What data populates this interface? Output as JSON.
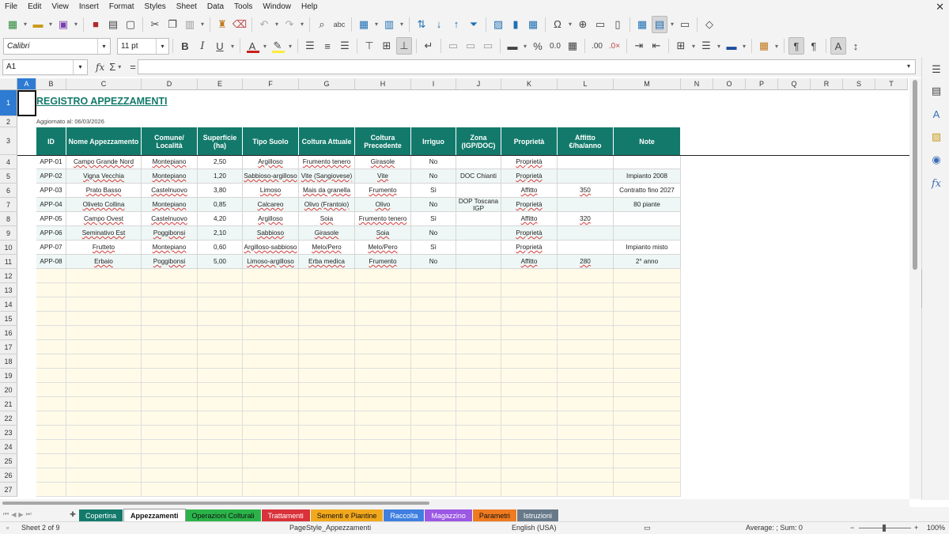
{
  "menu": [
    "File",
    "Edit",
    "View",
    "Insert",
    "Format",
    "Styles",
    "Sheet",
    "Data",
    "Tools",
    "Window",
    "Help"
  ],
  "close_glyph": "✕",
  "toolbar2": {
    "font_name": "Calibri",
    "font_size": "11 pt"
  },
  "formula_bar": {
    "cell_ref": "A1",
    "fx": "fx",
    "sigma": "Σ",
    "equals": "="
  },
  "columns": [
    "A",
    "B",
    "C",
    "D",
    "E",
    "F",
    "G",
    "H",
    "I",
    "J",
    "K",
    "L",
    "M",
    "N",
    "O",
    "P",
    "Q",
    "R",
    "S",
    "T"
  ],
  "rows": [
    "1",
    "2",
    "3",
    "4",
    "5",
    "6",
    "7",
    "8",
    "9",
    "10",
    "11",
    "12",
    "13",
    "14",
    "15",
    "16",
    "17",
    "18",
    "19",
    "20",
    "21",
    "22",
    "23",
    "24",
    "25",
    "26",
    "27"
  ],
  "sheet": {
    "title": "REGISTRO APPEZZAMENTI",
    "subtitle": "Aggiornato al: 06/03/2026",
    "headers": [
      "ID",
      "Nome Appezzamento",
      "Comune/\nLocalità",
      "Superficie\n(ha)",
      "Tipo Suolo",
      "Coltura Attuale",
      "Coltura\nPrecedente",
      "Irriguo",
      "Zona\n(IGP/DOC)",
      "Proprietà",
      "Affitto\n€/ha/anno",
      "Note"
    ],
    "data": [
      [
        "APP-01",
        "Campo Grande Nord",
        "Montepiano",
        "2,50",
        "Argilloso",
        "Frumento tenero",
        "Girasole",
        "No",
        "",
        "Proprietà",
        "",
        ""
      ],
      [
        "APP-02",
        "Vigna Vecchia",
        "Montepiano",
        "1,20",
        "Sabbioso-argilloso",
        "Vite (Sangiovese)",
        "Vite",
        "No",
        "DOC Chianti",
        "Proprietà",
        "",
        "Impianto 2008"
      ],
      [
        "APP-03",
        "Prato Basso",
        "Castelnuovo",
        "3,80",
        "Limoso",
        "Mais da granella",
        "Frumento",
        "Sì",
        "",
        "Affitto",
        "350",
        "Contratto fino 2027"
      ],
      [
        "APP-04",
        "Oliveto Collina",
        "Montepiano",
        "0,85",
        "Calcareo",
        "Olivo (Frantoio)",
        "Olivo",
        "No",
        "DOP Toscana\nIGP",
        "Proprietà",
        "",
        "80 piante"
      ],
      [
        "APP-05",
        "Campo Ovest",
        "Castelnuovo",
        "4,20",
        "Argilloso",
        "Soia",
        "Frumento tenero",
        "Sì",
        "",
        "Affitto",
        "320",
        ""
      ],
      [
        "APP-06",
        "Seminativo Est",
        "Poggibonsi",
        "2,10",
        "Sabbioso",
        "Girasole",
        "Soia",
        "No",
        "",
        "Proprietà",
        "",
        ""
      ],
      [
        "APP-07",
        "Frutteto",
        "Montepiano",
        "0,60",
        "Argilloso-sabbioso",
        "Melo/Pero",
        "Melo/Pero",
        "Sì",
        "",
        "Proprietà",
        "",
        "Impianto misto"
      ],
      [
        "APP-08",
        "Erbaio",
        "Poggibonsi",
        "5,00",
        "Limoso-argilloso",
        "Erba medica",
        "Frumento",
        "No",
        "",
        "Affitto",
        "280",
        "2° anno"
      ]
    ]
  },
  "tabs": [
    {
      "label": "Copertina",
      "color": "#137a6b",
      "text": "#ffffff"
    },
    {
      "label": "Appezzamenti",
      "color": "#ffffff",
      "text": "#111111"
    },
    {
      "label": "Operazioni Colturali",
      "color": "#2bb34a",
      "text": "#111111"
    },
    {
      "label": "Trattamenti",
      "color": "#d9323a",
      "text": "#ffffff"
    },
    {
      "label": "Sementi e Piantine",
      "color": "#f2a81d",
      "text": "#111111"
    },
    {
      "label": "Raccolta",
      "color": "#3f7fe0",
      "text": "#ffffff"
    },
    {
      "label": "Magazzino",
      "color": "#9b58e3",
      "text": "#ffffff"
    },
    {
      "label": "Parametri",
      "color": "#ef7a1f",
      "text": "#111111"
    },
    {
      "label": "Istruzioni",
      "color": "#687a8a",
      "text": "#ffffff"
    }
  ],
  "status": {
    "sheet": "Sheet 2 of 9",
    "page_style": "PageStyle_Appezzamenti",
    "language": "English (USA)",
    "summary": "Average: ; Sum: 0",
    "zoom_minus": "−",
    "zoom_plus": "+",
    "zoom": "100%"
  },
  "colors": {
    "header_bg": "#137a6b",
    "empty_fill": "#fffbe8",
    "selection": "#2d7bd3"
  }
}
